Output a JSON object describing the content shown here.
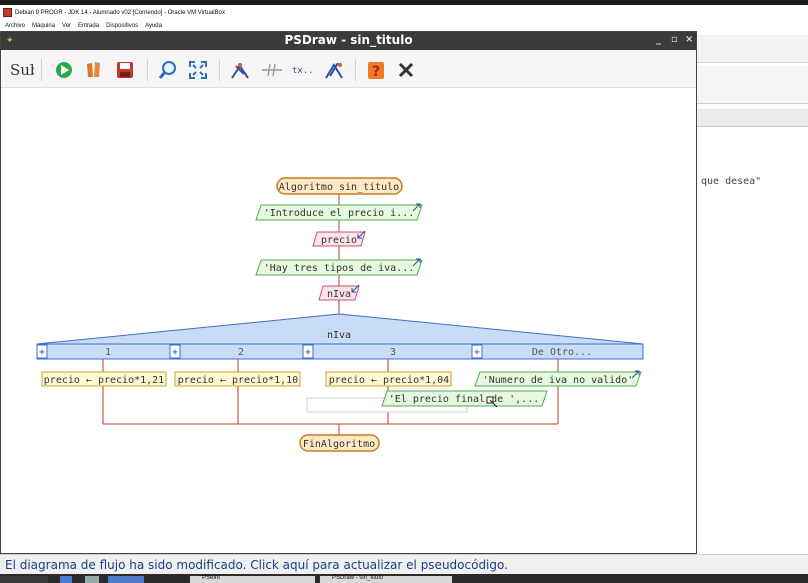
{
  "vbox": {
    "title": "Debian 9 PROGR - JDK 14 - Alumnado v02 [Corriendo] - Oracle VM VirtualBox",
    "menu": [
      "Archivo",
      "Máquina",
      "Ver",
      "Entrada",
      "Dispositivos",
      "Ayuda"
    ]
  },
  "background_window": {
    "text_fragment": "que desea\""
  },
  "psdraw": {
    "title": "PSDraw - sin_titulo",
    "window_controls": [
      "_",
      "▫",
      "×"
    ],
    "toolbar_icons": [
      "sub-icon",
      "run-icon",
      "step-icon",
      "save-icon",
      "zoom-icon",
      "fit-icon",
      "comment-icon",
      "variables-icon",
      "text-icon",
      "edit-icon",
      "help-icon",
      "close-icon"
    ],
    "toolbar_sub_label": "Sub"
  },
  "diagram": {
    "start": "Algoritmo sin_titulo",
    "steps": [
      {
        "kind": "output",
        "text": "'Introduce el precio i..."
      },
      {
        "kind": "input",
        "text": "precio"
      },
      {
        "kind": "output",
        "text": "'Hay tres tipos de iva..."
      },
      {
        "kind": "input",
        "text": "nIva"
      }
    ],
    "switch": {
      "variable": "nIva",
      "cases": [
        {
          "label": "1",
          "action": "precio ← precio*1,21"
        },
        {
          "label": "2",
          "action": "precio ← precio*1,10"
        },
        {
          "label": "3",
          "action": "precio ← precio*1,04"
        },
        {
          "label": "De Otro...",
          "action": "'Numero de iva no valido'"
        }
      ]
    },
    "floating_output": "'El precio final de ',...",
    "end": "FinAlgoritmo"
  },
  "status": {
    "text": "El diagrama de flujo ha sido modificado. Click aquí para actualizar el pseudocódigo."
  },
  "taskbar": {
    "items": [
      "PSeInt",
      "PSDraw - sin_titulo"
    ]
  },
  "colors": {
    "terminal_fill": "#fde9c4",
    "terminal_stroke": "#c77a1e",
    "output_fill": "#e6f8e0",
    "output_stroke": "#4fae4f",
    "input_fill": "#fde3ea",
    "input_stroke": "#c8506e",
    "switch_fill": "#c9dcf6",
    "switch_stroke": "#3f6ed0",
    "assign_fill": "#fff8d0",
    "assign_stroke": "#c7a42a",
    "connector": "#c0392b",
    "status_text": "#1b3d8a"
  }
}
